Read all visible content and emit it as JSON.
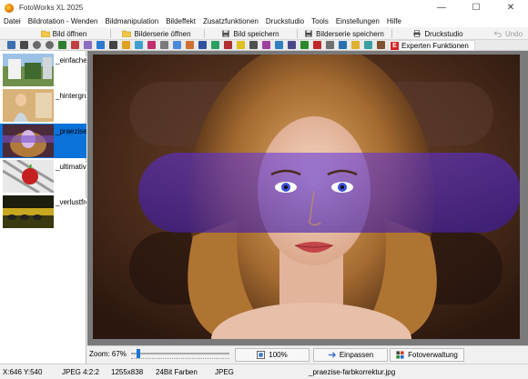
{
  "window": {
    "title": "FotoWorks XL 2025",
    "controls": [
      "—",
      "☐",
      "✕"
    ]
  },
  "menu": [
    "Datei",
    "Bildrotation - Wenden",
    "Bildmanipulation",
    "Bildeffekt",
    "Zusatzfunktionen",
    "Druckstudio",
    "Tools",
    "Einstellungen",
    "Hilfe"
  ],
  "toolbar": {
    "open_image": "Bild öffnen",
    "open_series": "Bilderserie öffnen",
    "save_image": "Bild speichern",
    "save_series": "Bilderserie speichern",
    "print_studio": "Druckstudio",
    "undo": "Undo",
    "expert_badge": "E",
    "expert": "Experten Funktionen"
  },
  "thumbnails": [
    {
      "label": "_einfache-"
    },
    {
      "label": "_hintergrund"
    },
    {
      "label": "_praezise-"
    },
    {
      "label": "_ultimative"
    },
    {
      "label": "_verlustfre"
    }
  ],
  "zoom": {
    "label": "Zoom: 67%",
    "level": 0.06
  },
  "bottom_buttons": {
    "hundred": "100%",
    "fit": "Einpassen",
    "manager": "Fotoverwaltung"
  },
  "status": {
    "coords": "X:646 Y:540",
    "format": "JPEG  4:2:2",
    "size": "1255x838",
    "colors": "24Bit Farben",
    "type": "JPEG",
    "filename": "_praezise-farbkorrektur.jpg"
  },
  "colors": {
    "accent": "#0a72d8",
    "expert_red": "#d42323"
  }
}
